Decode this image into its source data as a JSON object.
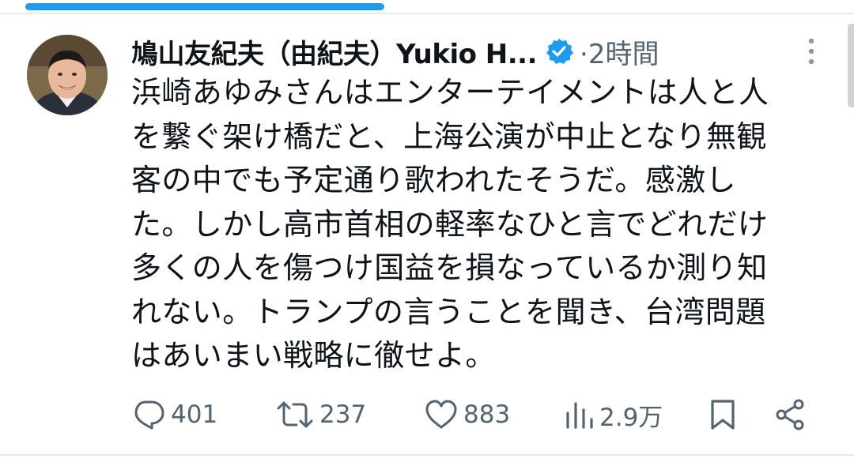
{
  "tweet": {
    "author_name": "鳩山友紀夫（由紀夫）Yukio H...",
    "verified_icon": "verified-badge-icon",
    "time": "2時間",
    "more_icon": "more-vertical-icon",
    "text_lines": [
      "浜崎あゆみさんはエンターテイメントは人と人",
      "を繋ぐ架け橋だと、上海公演が中止となり無観",
      "客の中でも予定通り歌われたそうだ。感激し",
      "た。しかし高市首相の軽率なひと言でどれだけ",
      "多くの人を傷つけ国益を損なっているか測り知",
      "れない。トランプの言うことを聞き、台湾問題",
      "はあいまい戦略に徹せよ。"
    ]
  },
  "actions": {
    "reply": {
      "icon": "reply-icon",
      "count": "401"
    },
    "retweet": {
      "icon": "retweet-icon",
      "count": "237"
    },
    "like": {
      "icon": "heart-icon",
      "count": "883"
    },
    "views": {
      "icon": "views-bar-chart-icon",
      "count": "2.9万"
    },
    "bookmark": {
      "icon": "bookmark-icon"
    },
    "share": {
      "icon": "share-icon"
    }
  },
  "colors": {
    "accent": "#1d9bf0",
    "text": "#0f1419",
    "muted": "#536471"
  }
}
